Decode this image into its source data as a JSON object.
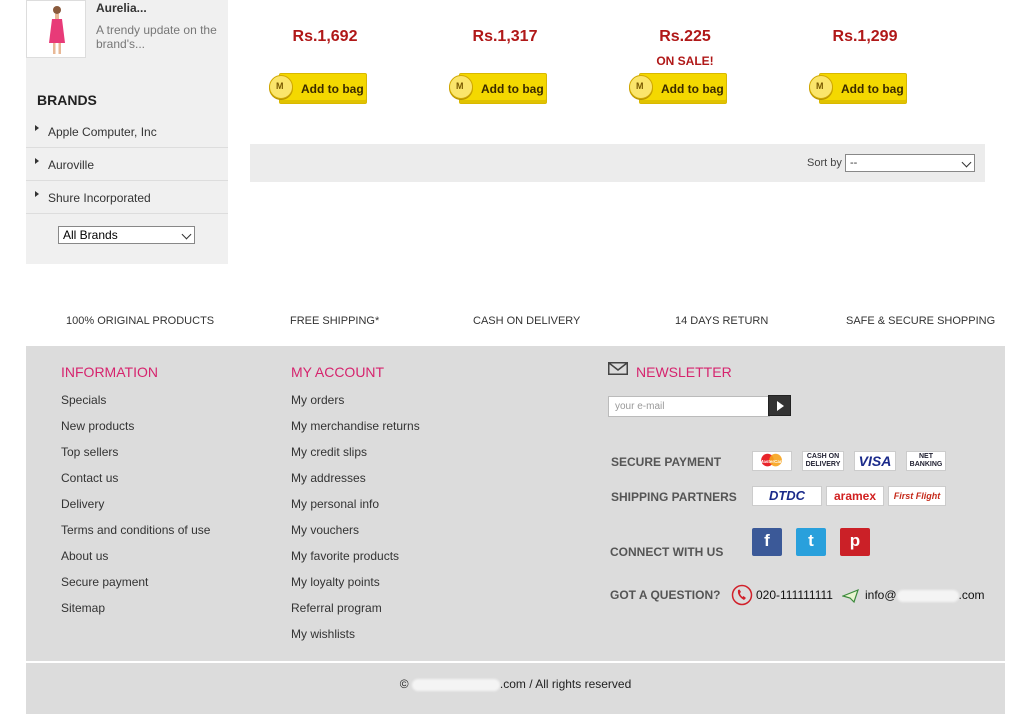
{
  "sidebar": {
    "product": {
      "name": "Aurelia...",
      "description": "A trendy update on the brand's..."
    },
    "brands_title": "BRANDS",
    "brands": [
      {
        "label": "Apple Computer, Inc"
      },
      {
        "label": "Auroville"
      },
      {
        "label": "Shure Incorporated"
      }
    ],
    "brand_select": "All Brands"
  },
  "products": [
    {
      "price": "Rs.1,692",
      "sale": "",
      "button": "Add to bag"
    },
    {
      "price": "Rs.1,317",
      "sale": "",
      "button": "Add to bag"
    },
    {
      "price": "Rs.225",
      "sale": "ON SALE!",
      "button": "Add to bag"
    },
    {
      "price": "Rs.1,299",
      "sale": "",
      "button": "Add to bag"
    }
  ],
  "button_badge": "M",
  "sort": {
    "label": "Sort by",
    "value": "--"
  },
  "features": [
    "100% ORIGINAL PRODUCTS",
    "FREE SHIPPING*",
    "CASH ON DELIVERY",
    "14 DAYS RETURN",
    "SAFE & SECURE SHOPPING"
  ],
  "footer": {
    "information": {
      "title": "INFORMATION",
      "links": [
        "Specials",
        "New products",
        "Top sellers",
        "Contact us",
        "Delivery",
        "Terms and conditions of use",
        "About us",
        "Secure payment",
        "Sitemap"
      ]
    },
    "account": {
      "title": "MY ACCOUNT",
      "links": [
        "My orders",
        "My merchandise returns",
        "My credit slips",
        "My addresses",
        "My personal info",
        "My vouchers",
        "My favorite products",
        "My loyalty points",
        "Referral program",
        "My wishlists"
      ]
    },
    "newsletter": {
      "title": "NEWSLETTER",
      "placeholder": "your e-mail"
    },
    "secure_payment": "SECURE PAYMENT",
    "payment_logos": [
      "MasterCard",
      "CASH ON DELIVERY",
      "VISA",
      "NET BANKING"
    ],
    "shipping_partners": "SHIPPING PARTNERS",
    "shipping_logos": [
      "DTDC",
      "aramex",
      "First Flight"
    ],
    "connect": "CONNECT WITH US",
    "social": [
      "f",
      "t",
      "p"
    ],
    "question": "GOT A QUESTION?",
    "phone": "020-111111111",
    "email_prefix": "info@",
    "email_suffix": ".com",
    "copyright_prefix": "©",
    "copyright_suffix": ".com / All rights reserved"
  },
  "colors": {
    "accent": "#d6246e",
    "price": "#b01818",
    "button": "#f4d800"
  }
}
